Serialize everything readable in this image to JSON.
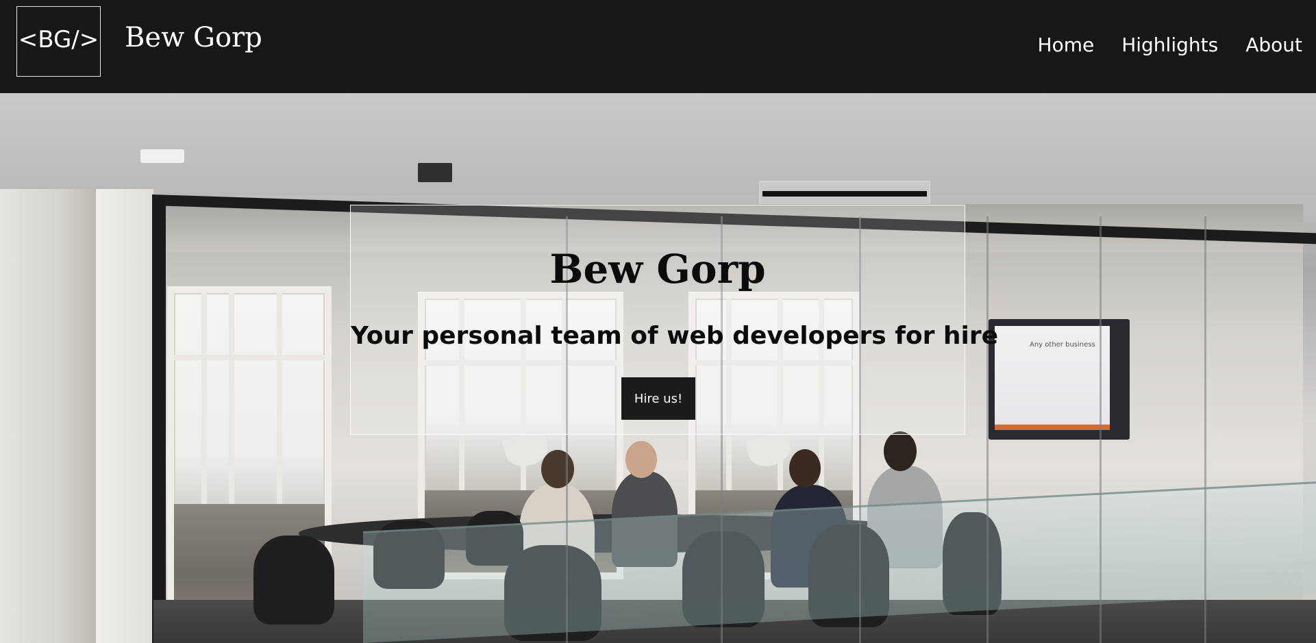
{
  "header": {
    "logo_text": "<BG/>",
    "brand_name": "Bew Gorp",
    "nav": [
      {
        "label": "Home"
      },
      {
        "label": "Highlights"
      },
      {
        "label": "About"
      }
    ]
  },
  "hero": {
    "title": "Bew Gorp",
    "subtitle": "Your personal team of web developers for hire",
    "cta_label": "Hire us!",
    "background_image": "office-meeting-room-photo",
    "screen_text": "Any other business"
  },
  "colors": {
    "header_bg": "#171717",
    "button_bg": "#1b1b1b",
    "text_light": "#ffffff",
    "text_dark": "#0b0b0b"
  }
}
